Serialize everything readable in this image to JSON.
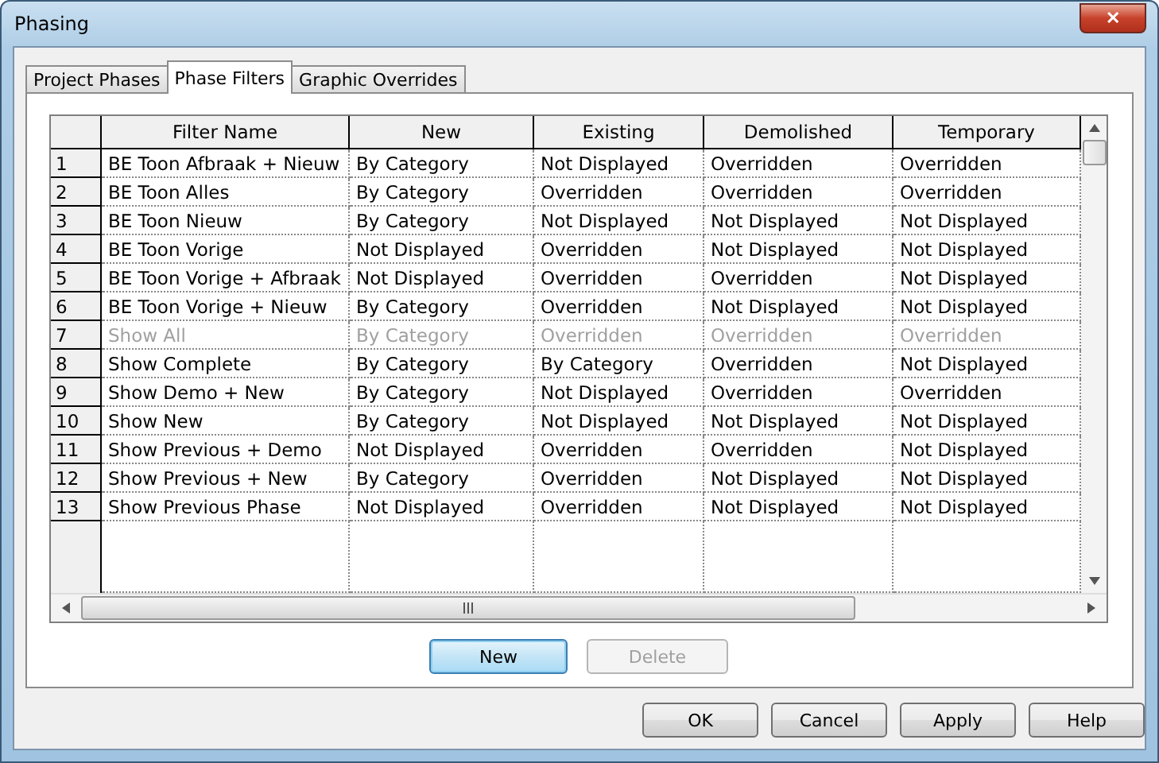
{
  "window": {
    "title": "Phasing",
    "close_label": "✕"
  },
  "tabs": [
    {
      "label": "Project Phases",
      "selected": false
    },
    {
      "label": "Phase Filters",
      "selected": true
    },
    {
      "label": "Graphic Overrides",
      "selected": false
    }
  ],
  "table": {
    "columns": [
      "Filter Name",
      "New",
      "Existing",
      "Demolished",
      "Temporary"
    ],
    "rows": [
      {
        "number": "1",
        "disabled": false,
        "cells": [
          "BE Toon Afbraak + Nieuw",
          "By Category",
          "Not Displayed",
          "Overridden",
          "Overridden"
        ]
      },
      {
        "number": "2",
        "disabled": false,
        "cells": [
          "BE Toon Alles",
          "By Category",
          "Overridden",
          "Overridden",
          "Overridden"
        ]
      },
      {
        "number": "3",
        "disabled": false,
        "cells": [
          "BE Toon Nieuw",
          "By Category",
          "Not Displayed",
          "Not Displayed",
          "Not Displayed"
        ]
      },
      {
        "number": "4",
        "disabled": false,
        "cells": [
          "BE Toon Vorige",
          "Not Displayed",
          "Overridden",
          "Not Displayed",
          "Not Displayed"
        ]
      },
      {
        "number": "5",
        "disabled": false,
        "cells": [
          "BE Toon Vorige + Afbraak",
          "Not Displayed",
          "Overridden",
          "Overridden",
          "Not Displayed"
        ]
      },
      {
        "number": "6",
        "disabled": false,
        "cells": [
          "BE Toon Vorige + Nieuw",
          "By Category",
          "Overridden",
          "Not Displayed",
          "Not Displayed"
        ]
      },
      {
        "number": "7",
        "disabled": true,
        "cells": [
          "Show All",
          "By Category",
          "Overridden",
          "Overridden",
          "Overridden"
        ]
      },
      {
        "number": "8",
        "disabled": false,
        "cells": [
          "Show Complete",
          "By Category",
          "By Category",
          "Overridden",
          "Not Displayed"
        ]
      },
      {
        "number": "9",
        "disabled": false,
        "cells": [
          "Show Demo + New",
          "By Category",
          "Not Displayed",
          "Overridden",
          "Overridden"
        ]
      },
      {
        "number": "10",
        "disabled": false,
        "cells": [
          "Show New",
          "By Category",
          "Not Displayed",
          "Not Displayed",
          "Not Displayed"
        ]
      },
      {
        "number": "11",
        "disabled": false,
        "cells": [
          "Show Previous + Demo",
          "Not Displayed",
          "Overridden",
          "Overridden",
          "Not Displayed"
        ]
      },
      {
        "number": "12",
        "disabled": false,
        "cells": [
          "Show Previous + New",
          "By Category",
          "Overridden",
          "Not Displayed",
          "Not Displayed"
        ]
      },
      {
        "number": "13",
        "disabled": false,
        "cells": [
          "Show Previous Phase",
          "Not Displayed",
          "Overridden",
          "Not Displayed",
          "Not Displayed"
        ]
      }
    ]
  },
  "panel_buttons": [
    {
      "label": "New",
      "disabled": false,
      "focused": true
    },
    {
      "label": "Delete",
      "disabled": true,
      "focused": false
    }
  ],
  "dialog_buttons": [
    {
      "label": "OK"
    },
    {
      "label": "Cancel"
    },
    {
      "label": "Apply"
    },
    {
      "label": "Help"
    }
  ]
}
